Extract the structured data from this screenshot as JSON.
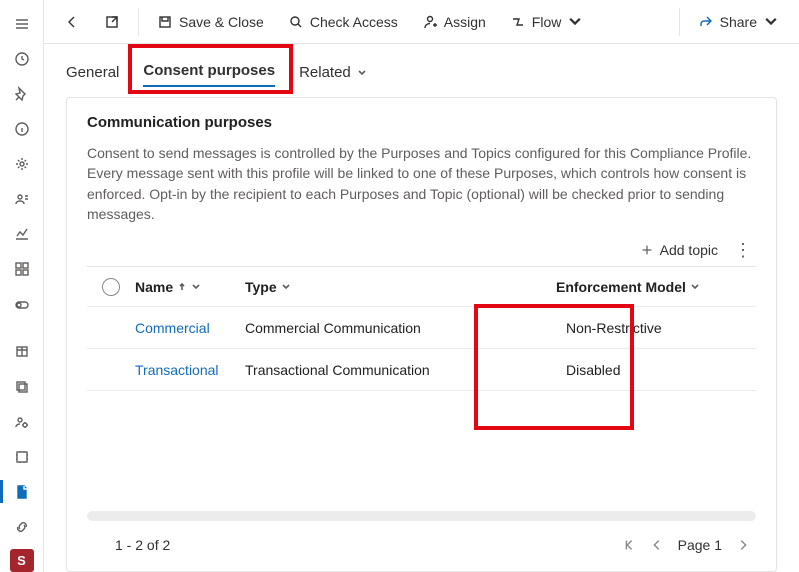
{
  "commandbar": {
    "save_close": "Save & Close",
    "check_access": "Check Access",
    "assign": "Assign",
    "flow": "Flow",
    "share": "Share"
  },
  "tabs": {
    "general": "General",
    "consent_purposes": "Consent purposes",
    "related": "Related"
  },
  "card": {
    "title": "Communication purposes",
    "description": "Consent to send messages is controlled by the Purposes and Topics configured for this Compliance Profile. Every message sent with this profile will be linked to one of these Purposes, which controls how consent is enforced. Opt-in by the recipient to each Purposes and Topic (optional) will be checked prior to sending messages.",
    "add_topic": "Add topic",
    "columns": {
      "name": "Name",
      "type": "Type",
      "enforcement_model": "Enforcement Model"
    },
    "rows": [
      {
        "name": "Commercial",
        "type": "Commercial Communication",
        "enforcement_model": "Non-Restrictive"
      },
      {
        "name": "Transactional",
        "type": "Transactional Communication",
        "enforcement_model": "Disabled"
      }
    ],
    "pager": {
      "summary": "1 - 2 of 2",
      "page_label": "Page 1"
    }
  },
  "siderail_badge": "S"
}
